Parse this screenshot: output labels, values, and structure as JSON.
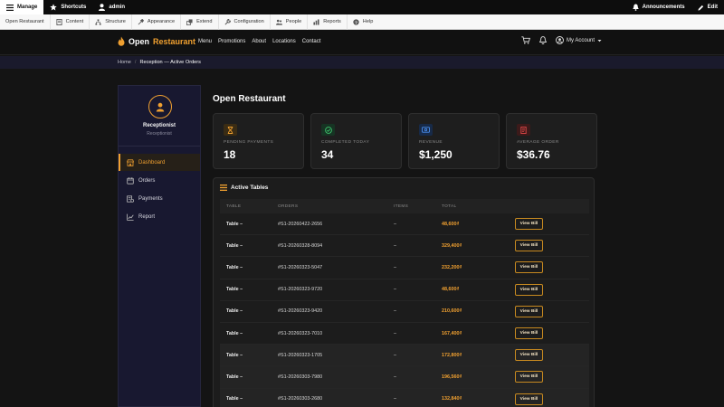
{
  "admin_bar": {
    "manage": "Manage",
    "shortcuts": "Shortcuts",
    "user": "admin",
    "announcements": "Announcements",
    "edit": "Edit"
  },
  "tray": {
    "items": [
      {
        "label": "Open Restaurant",
        "icon": "none"
      },
      {
        "label": "Content",
        "icon": "content-icon"
      },
      {
        "label": "Structure",
        "icon": "structure-icon"
      },
      {
        "label": "Appearance",
        "icon": "appearance-icon"
      },
      {
        "label": "Extend",
        "icon": "extend-icon"
      },
      {
        "label": "Configuration",
        "icon": "wrench-icon"
      },
      {
        "label": "People",
        "icon": "people-icon"
      },
      {
        "label": "Reports",
        "icon": "reports-icon"
      },
      {
        "label": "Help",
        "icon": "help-icon"
      }
    ]
  },
  "header": {
    "brand_open": "Open",
    "brand_restaurant": "Restaurant",
    "nav": [
      "Menu",
      "Promotions",
      "About",
      "Locations",
      "Contact"
    ],
    "account": "My Account"
  },
  "breadcrumb": {
    "home": "Home",
    "separator": "/",
    "current": "Reception — Active Orders"
  },
  "sidebar": {
    "role_title": "Receptionist",
    "role_sub": "Receptionist",
    "items": [
      {
        "label": "Dashboard",
        "icon": "store-icon",
        "active": true
      },
      {
        "label": "Orders",
        "icon": "orders-icon",
        "active": false
      },
      {
        "label": "Payments",
        "icon": "payments-icon",
        "active": false
      },
      {
        "label": "Report",
        "icon": "chart-icon",
        "active": false
      }
    ]
  },
  "main": {
    "title": "Open Restaurant",
    "stats": [
      {
        "label": "PENDING PAYMENTS",
        "value": "18",
        "icon": "hourglass-icon",
        "color": "#f0a030"
      },
      {
        "label": "COMPLETED TODAY",
        "value": "34",
        "icon": "check-circle-icon",
        "color": "#3ec46d"
      },
      {
        "label": "REVENUE",
        "value": "$1,250",
        "icon": "cash-icon",
        "color": "#4a8ff0"
      },
      {
        "label": "AVERAGE ORDER",
        "value": "$36.76",
        "icon": "receipt-icon",
        "color": "#e04848"
      }
    ],
    "tables_title": "Active Tables",
    "columns": [
      "TABLE",
      "ORDERS",
      "ITEMS",
      "TOTAL"
    ],
    "view_label": "View Bill",
    "rows": [
      {
        "table": "Table –",
        "order": "#S1-20260422-2656",
        "items": "–",
        "total": "48,600₫"
      },
      {
        "table": "Table –",
        "order": "#S1-20260328-8094",
        "items": "–",
        "total": "329,400₫"
      },
      {
        "table": "Table –",
        "order": "#S1-20260323-5047",
        "items": "–",
        "total": "232,200₫"
      },
      {
        "table": "Table –",
        "order": "#S1-20260323-9720",
        "items": "–",
        "total": "48,600₫"
      },
      {
        "table": "Table –",
        "order": "#S1-20260323-9420",
        "items": "–",
        "total": "210,600₫"
      },
      {
        "table": "Table –",
        "order": "#S1-20260323-7010",
        "items": "–",
        "total": "167,400₫"
      },
      {
        "table": "Table –",
        "order": "#S1-20260323-1705",
        "items": "–",
        "total": "172,800₫"
      },
      {
        "table": "Table –",
        "order": "#S1-20260303-7980",
        "items": "–",
        "total": "196,560₫"
      },
      {
        "table": "Table –",
        "order": "#S1-20260303-2680",
        "items": "–",
        "total": "132,840₫"
      }
    ]
  }
}
